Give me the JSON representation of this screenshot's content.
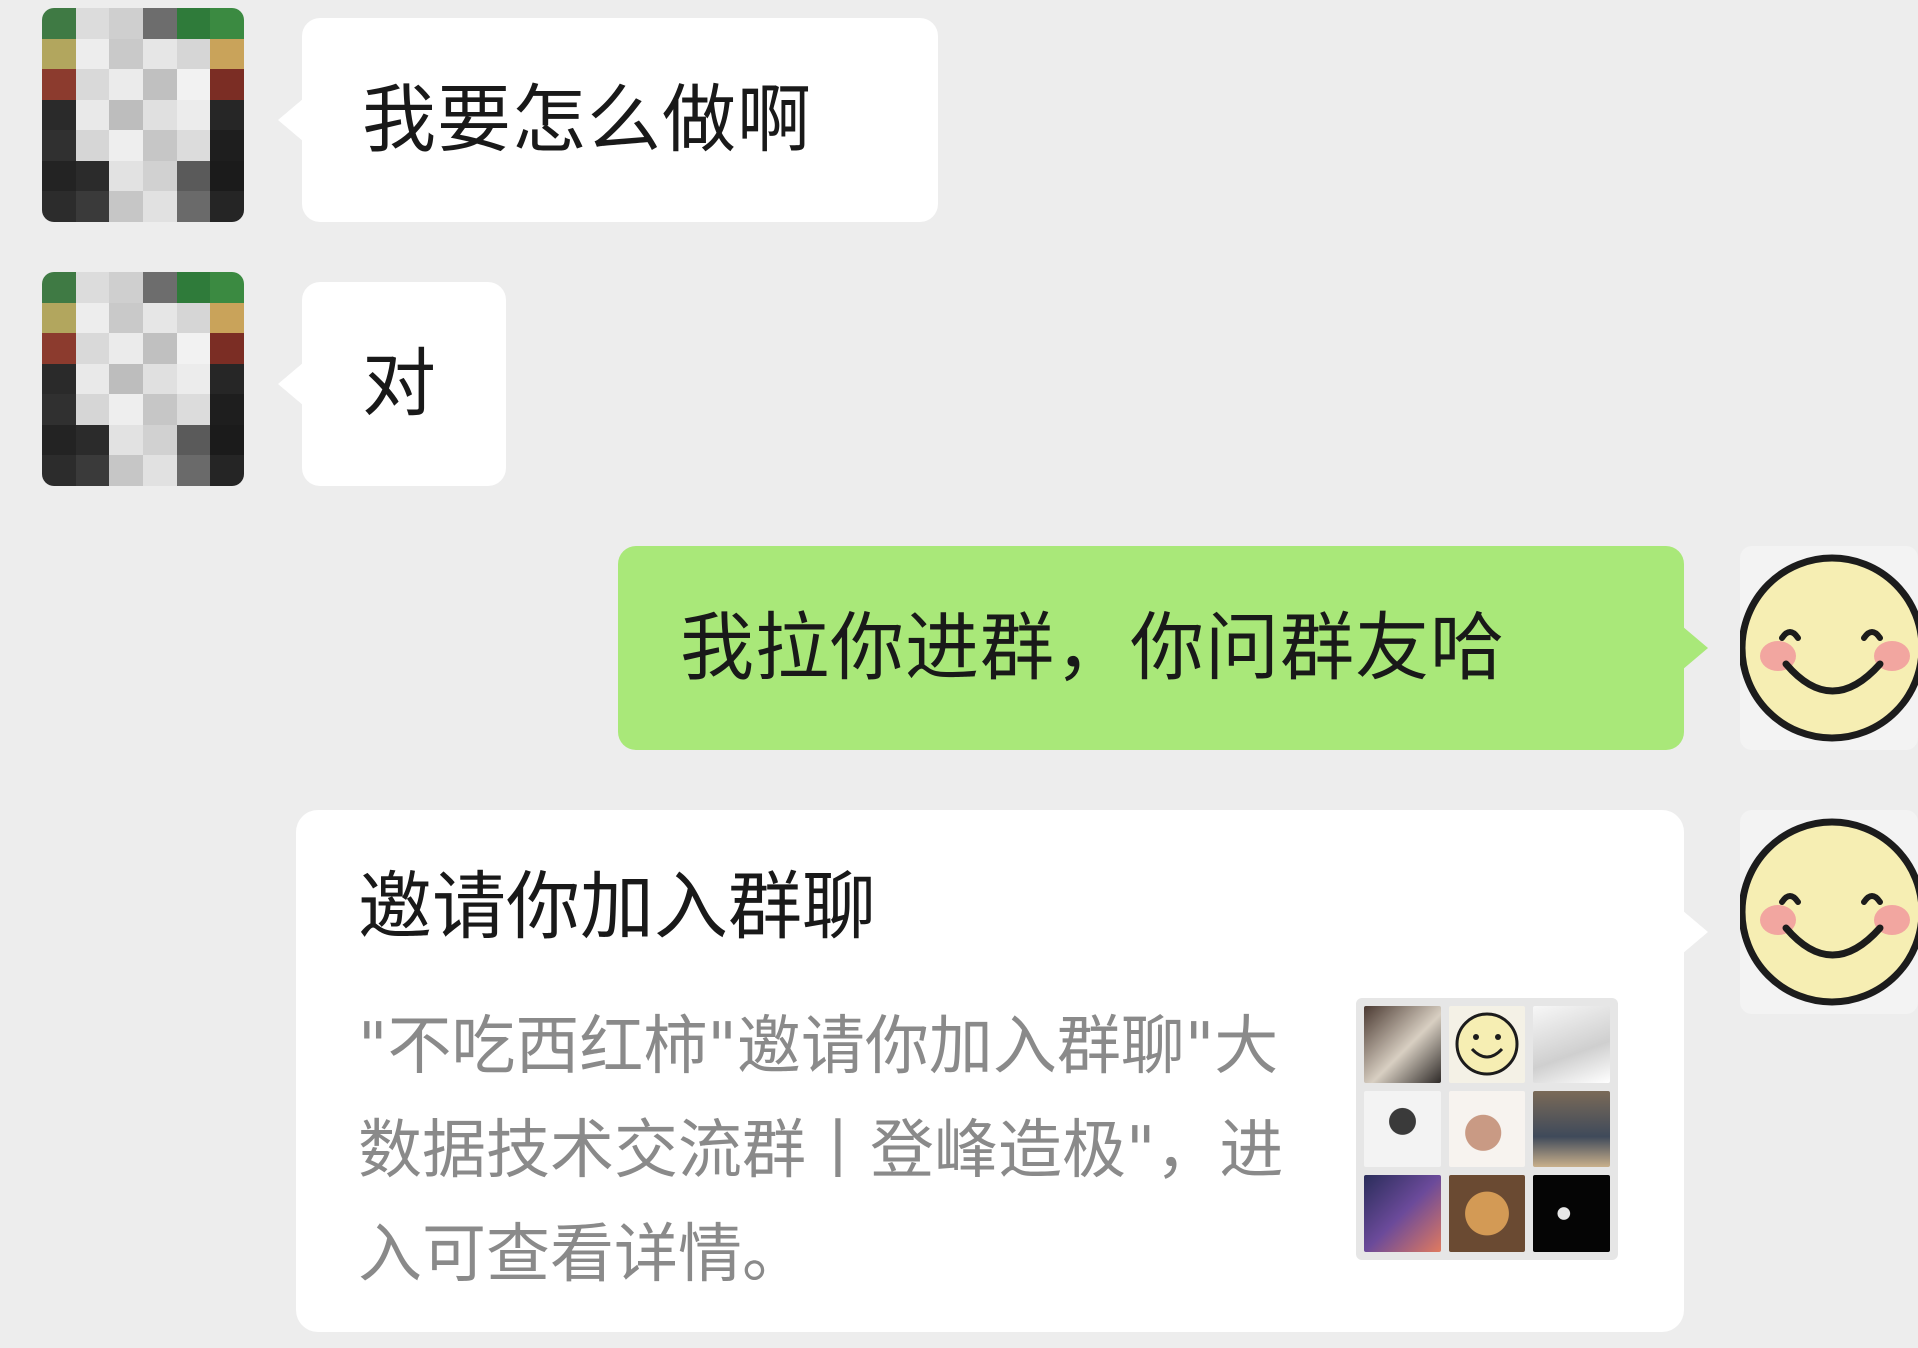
{
  "messages": [
    {
      "id": "m1",
      "side": "left",
      "text": "我要怎么做啊"
    },
    {
      "id": "m2",
      "side": "left",
      "text": "对"
    },
    {
      "id": "m3",
      "side": "right",
      "text": "我拉你进群，你问群友哈"
    }
  ],
  "invite_card": {
    "title": "邀请你加入群聊",
    "description": "\"不吃西红柿\"邀请你加入群聊\"大数据技术交流群丨登峰造极\"，进入可查看详情。"
  },
  "avatars": {
    "contact": "pixelated-avatar",
    "self": "smiley-face-icon"
  },
  "colors": {
    "background": "#ededed",
    "incoming_bubble": "#ffffff",
    "outgoing_bubble": "#a9e879",
    "secondary_text": "#8a8a8a"
  }
}
